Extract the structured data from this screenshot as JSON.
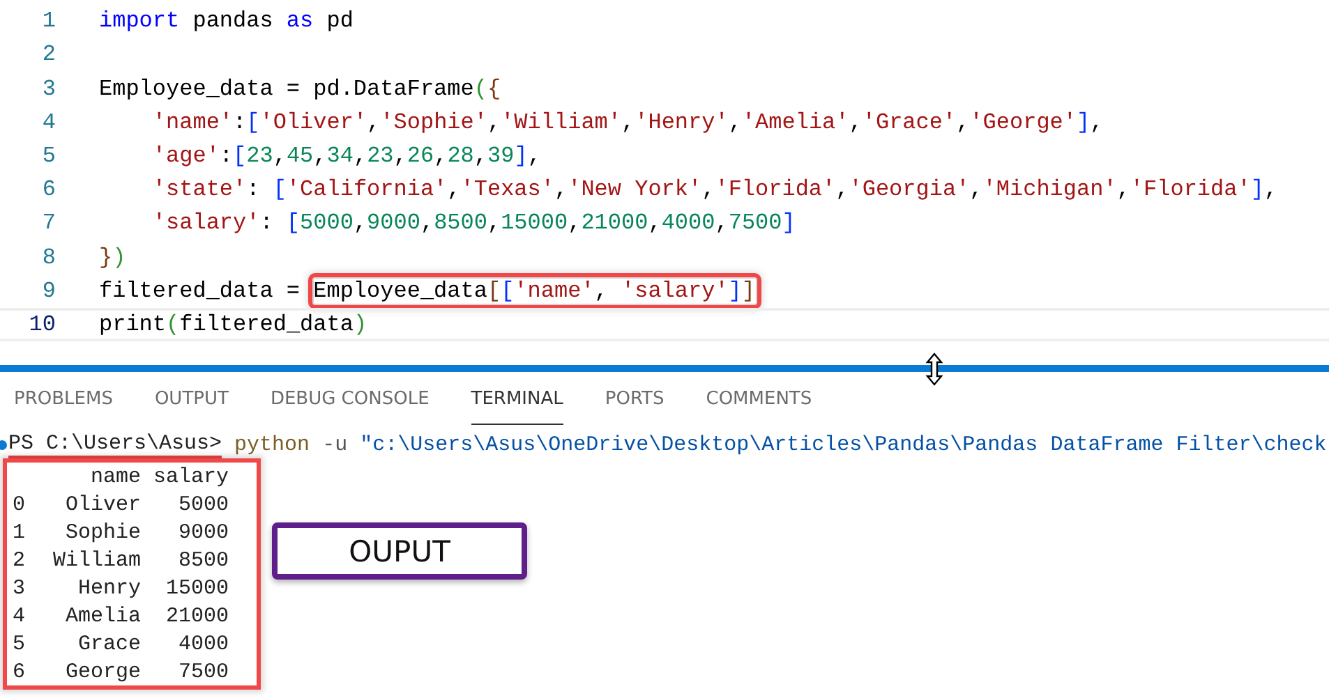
{
  "editor": {
    "lines": [
      {
        "number": "1",
        "current": false,
        "segments": [
          {
            "boxed": false,
            "tokens": [
              {
                "text": "import",
                "kind": "keyword"
              },
              {
                "text": " pandas ",
                "kind": "plain"
              },
              {
                "text": "as",
                "kind": "keyword"
              },
              {
                "text": " pd",
                "kind": "plain"
              }
            ]
          }
        ]
      },
      {
        "number": "2",
        "current": false
      },
      {
        "number": "3",
        "current": false,
        "segments": [
          {
            "boxed": false,
            "tokens": [
              {
                "text": "Employee_data = pd.DataFrame",
                "kind": "plain"
              },
              {
                "text": "(",
                "kind": "bracket"
              },
              {
                "text": "{",
                "kind": "bracket2"
              }
            ]
          }
        ]
      },
      {
        "number": "4",
        "current": false,
        "segments": [
          {
            "boxed": false,
            "tokens": [
              {
                "text": "    'name'",
                "kind": "string"
              },
              {
                "text": ":",
                "kind": "plain"
              },
              {
                "text": "[",
                "kind": "bracket3"
              },
              {
                "text": "'Oliver'",
                "kind": "string"
              },
              {
                "text": ",",
                "kind": "plain"
              },
              {
                "text": "'Sophie'",
                "kind": "string"
              },
              {
                "text": ",",
                "kind": "plain"
              },
              {
                "text": "'William'",
                "kind": "string"
              },
              {
                "text": ",",
                "kind": "plain"
              },
              {
                "text": "'Henry'",
                "kind": "string"
              },
              {
                "text": ",",
                "kind": "plain"
              },
              {
                "text": "'Amelia'",
                "kind": "string"
              },
              {
                "text": ",",
                "kind": "plain"
              },
              {
                "text": "'Grace'",
                "kind": "string"
              },
              {
                "text": ",",
                "kind": "plain"
              },
              {
                "text": "'George'",
                "kind": "string"
              },
              {
                "text": "]",
                "kind": "bracket3"
              },
              {
                "text": ",",
                "kind": "plain"
              }
            ]
          }
        ]
      },
      {
        "number": "5",
        "current": false,
        "segments": [
          {
            "boxed": false,
            "tokens": [
              {
                "text": "    'age'",
                "kind": "string"
              },
              {
                "text": ":",
                "kind": "plain"
              },
              {
                "text": "[",
                "kind": "bracket3"
              },
              {
                "text": "23",
                "kind": "number"
              },
              {
                "text": ",",
                "kind": "plain"
              },
              {
                "text": "45",
                "kind": "number"
              },
              {
                "text": ",",
                "kind": "plain"
              },
              {
                "text": "34",
                "kind": "number"
              },
              {
                "text": ",",
                "kind": "plain"
              },
              {
                "text": "23",
                "kind": "number"
              },
              {
                "text": ",",
                "kind": "plain"
              },
              {
                "text": "26",
                "kind": "number"
              },
              {
                "text": ",",
                "kind": "plain"
              },
              {
                "text": "28",
                "kind": "number"
              },
              {
                "text": ",",
                "kind": "plain"
              },
              {
                "text": "39",
                "kind": "number"
              },
              {
                "text": "]",
                "kind": "bracket3"
              },
              {
                "text": ",",
                "kind": "plain"
              }
            ]
          }
        ]
      },
      {
        "number": "6",
        "current": false,
        "segments": [
          {
            "boxed": false,
            "tokens": [
              {
                "text": "    'state'",
                "kind": "string"
              },
              {
                "text": ": ",
                "kind": "plain"
              },
              {
                "text": "[",
                "kind": "bracket3"
              },
              {
                "text": "'California'",
                "kind": "string"
              },
              {
                "text": ",",
                "kind": "plain"
              },
              {
                "text": "'Texas'",
                "kind": "string"
              },
              {
                "text": ",",
                "kind": "plain"
              },
              {
                "text": "'New York'",
                "kind": "string"
              },
              {
                "text": ",",
                "kind": "plain"
              },
              {
                "text": "'Florida'",
                "kind": "string"
              },
              {
                "text": ",",
                "kind": "plain"
              },
              {
                "text": "'Georgia'",
                "kind": "string"
              },
              {
                "text": ",",
                "kind": "plain"
              },
              {
                "text": "'Michigan'",
                "kind": "string"
              },
              {
                "text": ",",
                "kind": "plain"
              },
              {
                "text": "'Florida'",
                "kind": "string"
              },
              {
                "text": "]",
                "kind": "bracket3"
              },
              {
                "text": ",",
                "kind": "plain"
              }
            ]
          }
        ]
      },
      {
        "number": "7",
        "current": false,
        "segments": [
          {
            "boxed": false,
            "tokens": [
              {
                "text": "    'salary'",
                "kind": "string"
              },
              {
                "text": ": ",
                "kind": "plain"
              },
              {
                "text": "[",
                "kind": "bracket3"
              },
              {
                "text": "5000",
                "kind": "number"
              },
              {
                "text": ",",
                "kind": "plain"
              },
              {
                "text": "9000",
                "kind": "number"
              },
              {
                "text": ",",
                "kind": "plain"
              },
              {
                "text": "8500",
                "kind": "number"
              },
              {
                "text": ",",
                "kind": "plain"
              },
              {
                "text": "15000",
                "kind": "number"
              },
              {
                "text": ",",
                "kind": "plain"
              },
              {
                "text": "21000",
                "kind": "number"
              },
              {
                "text": ",",
                "kind": "plain"
              },
              {
                "text": "4000",
                "kind": "number"
              },
              {
                "text": ",",
                "kind": "plain"
              },
              {
                "text": "7500",
                "kind": "number"
              },
              {
                "text": "]",
                "kind": "bracket3"
              }
            ]
          }
        ]
      },
      {
        "number": "8",
        "current": false,
        "segments": [
          {
            "boxed": false,
            "tokens": [
              {
                "text": "}",
                "kind": "bracket2"
              },
              {
                "text": ")",
                "kind": "bracket"
              }
            ]
          }
        ]
      },
      {
        "number": "9",
        "current": false,
        "segments": [
          {
            "boxed": false,
            "tokens": [
              {
                "text": "filtered_data = ",
                "kind": "plain"
              }
            ]
          },
          {
            "boxed": true,
            "tokens": [
              {
                "text": "Employee_data",
                "kind": "plain"
              },
              {
                "text": "[",
                "kind": "bracket2"
              },
              {
                "text": "[",
                "kind": "bracket3"
              },
              {
                "text": "'name'",
                "kind": "string"
              },
              {
                "text": ", ",
                "kind": "plain"
              },
              {
                "text": "'salary'",
                "kind": "string"
              },
              {
                "text": "]",
                "kind": "bracket3"
              },
              {
                "text": "]",
                "kind": "bracket2"
              }
            ]
          }
        ]
      },
      {
        "number": "10",
        "current": true,
        "segments": [
          {
            "boxed": false,
            "tokens": [
              {
                "text": "print",
                "kind": "plain"
              },
              {
                "text": "(",
                "kind": "bracket"
              },
              {
                "text": "filtered_data",
                "kind": "plain"
              },
              {
                "text": ")",
                "kind": "bracket"
              }
            ]
          }
        ]
      }
    ]
  },
  "panel": {
    "tabs": [
      {
        "label": "PROBLEMS",
        "selected": false
      },
      {
        "label": "OUTPUT",
        "selected": false
      },
      {
        "label": "DEBUG CONSOLE",
        "selected": false
      },
      {
        "label": "TERMINAL",
        "selected": true
      },
      {
        "label": "PORTS",
        "selected": false
      },
      {
        "label": "COMMENTS",
        "selected": false
      }
    ],
    "command": {
      "prompt": "PS C:\\Users\\Asus>",
      "program": "python",
      "flag": "-u",
      "argument": "\"c:\\Users\\Asus\\OneDrive\\Desktop\\Articles\\Pandas\\Pandas DataFrame Filter\\check"
    },
    "output": {
      "columns": [
        "",
        "name",
        "salary"
      ],
      "rows": [
        [
          "0",
          "Oliver",
          "5000"
        ],
        [
          "1",
          "Sophie",
          "9000"
        ],
        [
          "2",
          "William",
          "8500"
        ],
        [
          "3",
          "Henry",
          "15000"
        ],
        [
          "4",
          "Amelia",
          "21000"
        ],
        [
          "5",
          "Grace",
          "4000"
        ],
        [
          "6",
          "George",
          "7500"
        ]
      ]
    },
    "callout": "OUPUT"
  }
}
